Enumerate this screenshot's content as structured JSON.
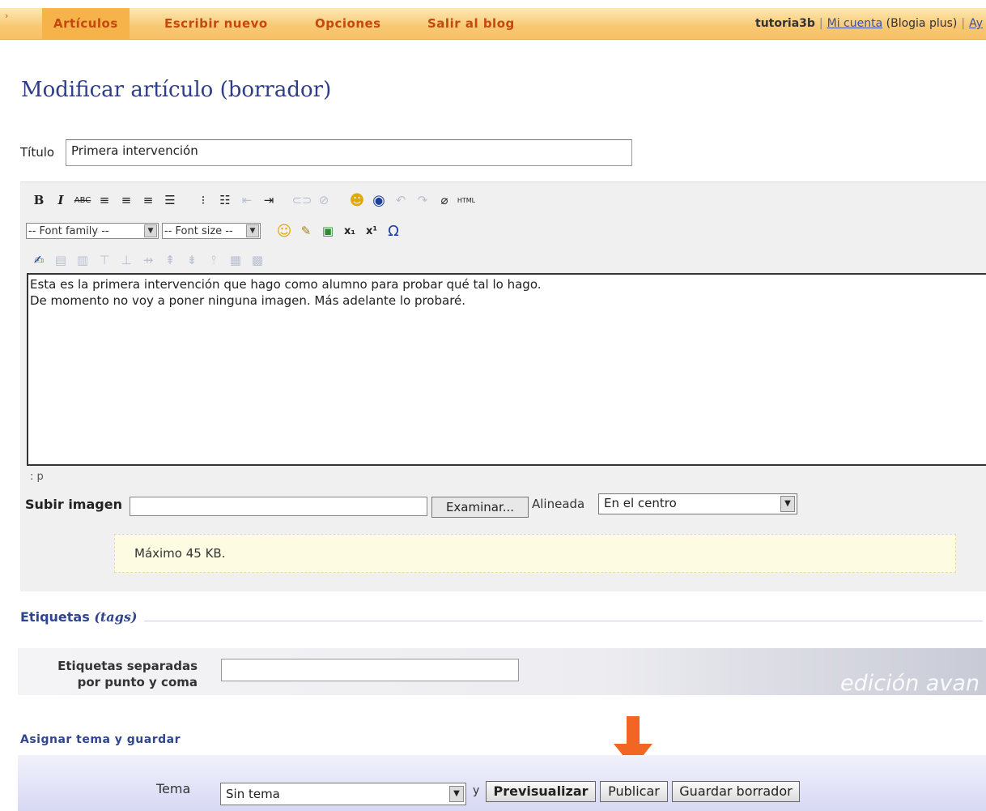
{
  "nav": {
    "edge_glyph": "›",
    "tabs": [
      "Artículos",
      "Escribir nuevo",
      "Opciones",
      "Salir al blog"
    ],
    "user": "tutoria3b",
    "account_link": "Mi cuenta",
    "plan": "(Blogia plus)",
    "trailing_link": "Ay"
  },
  "page": {
    "title": "Modificar artículo (borrador)"
  },
  "article": {
    "title_label": "Título",
    "title_value": "Primera intervención",
    "font_family_placeholder": "-- Font family --",
    "font_size_placeholder": "-- Font size --",
    "body_line1": "Esta es la primera intervención que hago como alumno para probar qué tal lo hago.",
    "body_line2": "De momento no voy a poner ninguna imagen. Más adelante lo probaré.",
    "path": ": p"
  },
  "upload": {
    "label": "Subir imagen",
    "browse_label": "Examinar...",
    "align_label": "Alineada",
    "align_value": "En el centro",
    "note": "Máximo 45 KB."
  },
  "tags": {
    "heading": "Etiquetas",
    "heading_em": "(tags)",
    "label_line1": "Etiquetas separadas",
    "label_line2": "por punto y coma",
    "watermark": "edición avan"
  },
  "save": {
    "heading": "Asignar tema y guardar",
    "tema_label": "Tema",
    "tema_value": "Sin tema",
    "y_text": "y",
    "preview_label": "Previsualizar",
    "publish_label": "Publicar",
    "draft_label": "Guardar borrador"
  },
  "colors": {
    "accent": "#f26522",
    "nav_text": "#c5480f",
    "heading": "#2e3d88"
  }
}
